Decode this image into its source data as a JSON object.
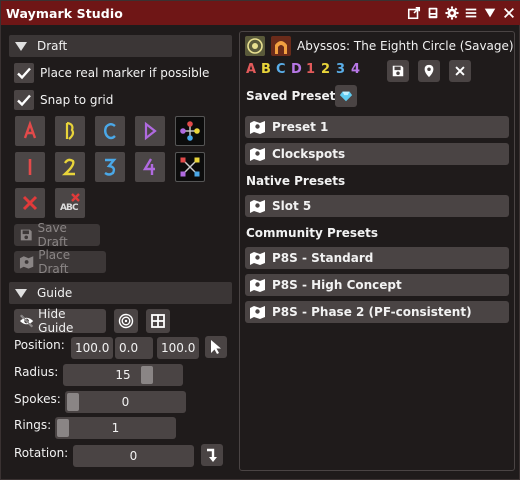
{
  "window": {
    "title": "Waymark Studio"
  },
  "draft": {
    "header": "Draft",
    "place_real_label": "Place real marker if possible",
    "snap_label": "Snap to grid",
    "waymarks": [
      {
        "glyph": "A",
        "color": "#e24a4a"
      },
      {
        "glyph": "B",
        "color": "#e8d43a"
      },
      {
        "glyph": "C",
        "color": "#4aa8e8"
      },
      {
        "glyph": "D",
        "color": "#b06ae0"
      },
      {
        "glyph": "1",
        "color": "#e24a4a"
      },
      {
        "glyph": "2",
        "color": "#e8d43a"
      },
      {
        "glyph": "3",
        "color": "#4aa8e8"
      },
      {
        "glyph": "4",
        "color": "#b06ae0"
      }
    ],
    "save_label": "Save Draft",
    "place_label": "Place Draft"
  },
  "guide": {
    "header": "Guide",
    "hide_label": "Hide Guide",
    "position_label": "Position:",
    "position": [
      "100.0",
      "0.0",
      "100.0"
    ],
    "radius_label": "Radius:",
    "radius": "15",
    "spokes_label": "Spokes:",
    "spokes": "0",
    "rings_label": "Rings:",
    "rings": "1",
    "rotation_label": "Rotation:",
    "rotation": "0"
  },
  "right": {
    "zone_name": "Abyssos: The Eighth Circle (Savage)",
    "letters": [
      {
        "t": "A",
        "c": "#e25a5a"
      },
      {
        "t": "B",
        "c": "#e8d43a"
      },
      {
        "t": "C",
        "c": "#5aaee8"
      },
      {
        "t": "D",
        "c": "#b777e6"
      },
      {
        "t": "1",
        "c": "#e25a5a"
      },
      {
        "t": "2",
        "c": "#e8d43a"
      },
      {
        "t": "3",
        "c": "#5aaee8"
      },
      {
        "t": "4",
        "c": "#b777e6"
      }
    ],
    "saved_label": "Saved Presets",
    "saved": [
      "Preset 1",
      "Clockspots"
    ],
    "native_label": "Native Presets",
    "native": [
      "Slot 5"
    ],
    "community_label": "Community Presets",
    "community": [
      "P8S - Standard",
      "P8S - High Concept",
      "P8S - Phase 2 (PF-consistent)"
    ]
  }
}
